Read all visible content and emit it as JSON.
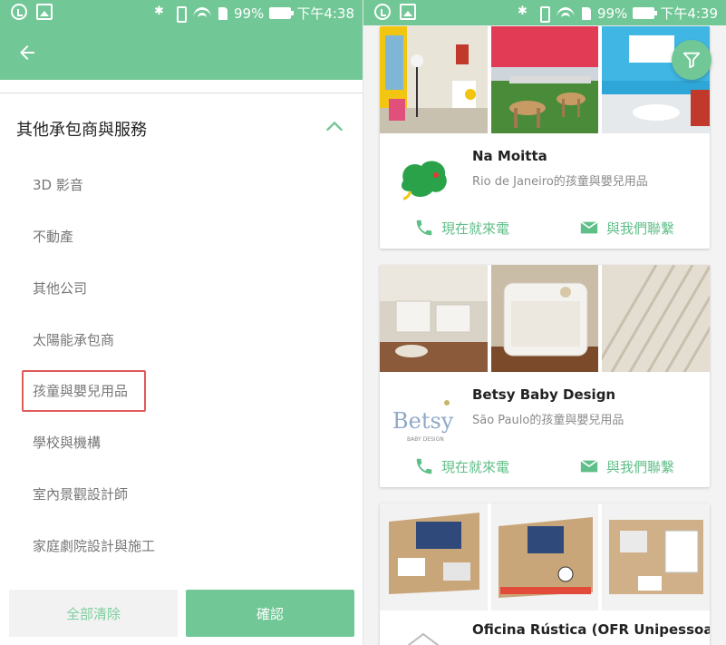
{
  "left": {
    "status": {
      "battery": "99%",
      "time": "下午4:38"
    },
    "section_title": "其他承包商與服務",
    "categories": [
      "3D 影音",
      "不動產",
      "其他公司",
      "太陽能承包商",
      "孩童與嬰兒用品",
      "學校與機構",
      "室內景觀設計師",
      "家庭劇院設計與施工"
    ],
    "clear_label": "全部清除",
    "confirm_label": "確認"
  },
  "right": {
    "status": {
      "battery": "99%",
      "time": "下午4:39"
    },
    "cards": [
      {
        "name": "Na Moitta",
        "subtitle": "Rio de Janeiro的孩童與嬰兒用品",
        "call_label": "現在就來電",
        "contact_label": "與我們聯繫"
      },
      {
        "name": "Betsy Baby Design",
        "subtitle": "São Paulo的孩童與嬰兒用品",
        "logo_text": "Betsy",
        "logo_subtext": "BABY DESIGN",
        "call_label": "現在就來電",
        "contact_label": "與我們聯繫"
      },
      {
        "name": "Oficina Rústica (OFR Unipessoal"
      }
    ]
  },
  "colors": {
    "accent": "#71c796",
    "action_text": "#5fbf88",
    "highlight": "#e05a5a"
  },
  "icons": [
    "back-arrow-icon",
    "chevron-up-icon",
    "filter-icon",
    "phone-icon",
    "mail-icon"
  ]
}
